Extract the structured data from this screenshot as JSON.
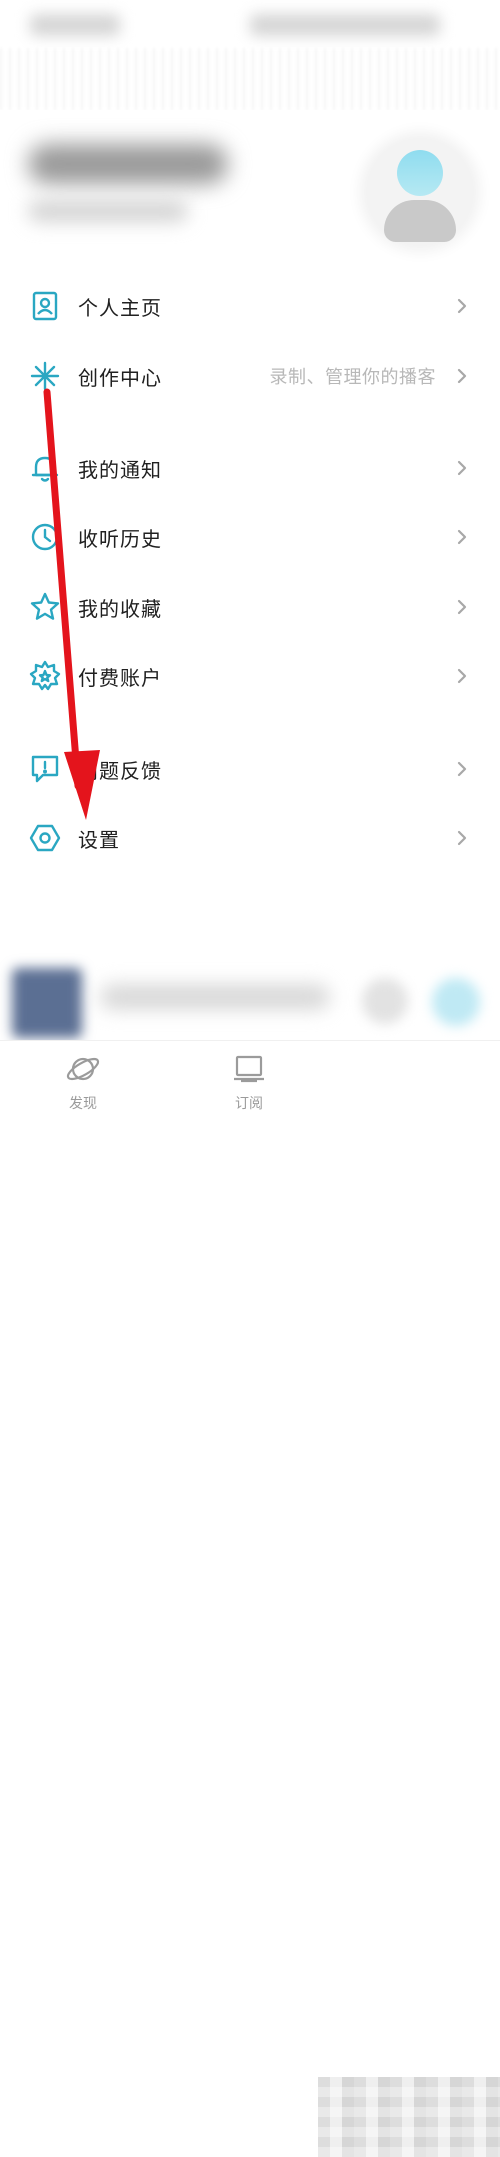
{
  "colors": {
    "accent": "#2aa7c2",
    "arrow": "#e4141c",
    "chevron": "#a8a8a8"
  },
  "menu": [
    {
      "label": "个人主页",
      "icon": "profile-card-icon"
    },
    {
      "label": "创作中心",
      "icon": "sparkle-icon",
      "hint": "录制、管理你的播客"
    },
    {
      "label": "我的通知",
      "icon": "bell-icon"
    },
    {
      "label": "收听历史",
      "icon": "clock-icon"
    },
    {
      "label": "我的收藏",
      "icon": "star-icon"
    },
    {
      "label": "付费账户",
      "icon": "badge-icon"
    },
    {
      "label": "问题反馈",
      "icon": "feedback-icon"
    },
    {
      "label": "设置",
      "icon": "settings-hexagon-icon"
    }
  ],
  "tabs": [
    {
      "label": "发现",
      "icon": "planet-icon"
    },
    {
      "label": "订阅",
      "icon": "monitor-icon"
    }
  ]
}
